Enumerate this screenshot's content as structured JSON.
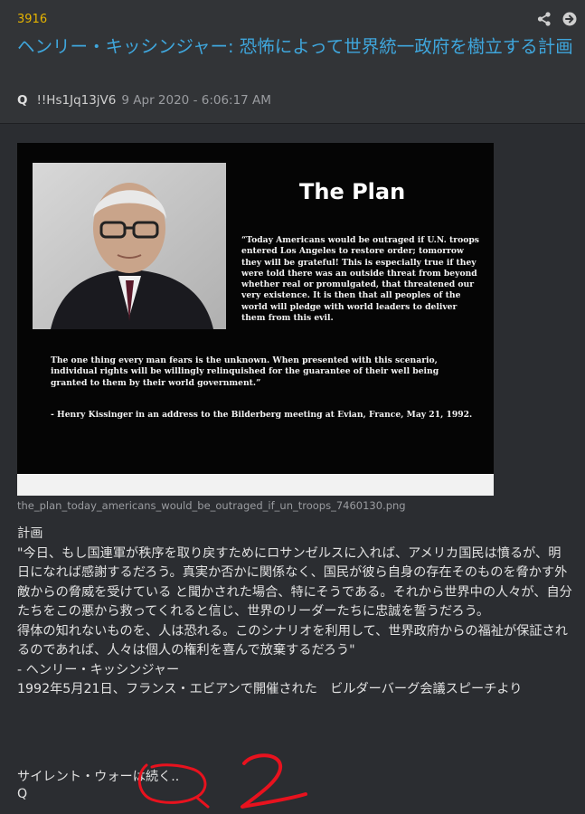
{
  "post": {
    "number": "3916",
    "title": "ヘンリー・キッシンジャー: 恐怖によって世界統一政府を樹立する計画",
    "author": "Q",
    "tripcode": "!!Hs1Jq13jV6",
    "timestamp": "9 Apr 2020 - 6:06:17 AM"
  },
  "icons": [
    "share-icon",
    "arrow-right-circle-icon"
  ],
  "image": {
    "heading": "The Plan",
    "quote_main": "“Today Americans would be outraged if U.N. troops entered Los Angeles to restore order; tomorrow they will be grateful! This is especially true if they were told there was an outside threat from beyond whether real or promulgated, that threatened our very existence. It is then that all peoples of the world will pledge with world leaders to deliver them from this evil.",
    "quote_second": "The one thing every man fears is the unknown. When presented with this scenario, individual rights will be willingly relinquished for the guarantee of their well being granted to them by their world government.”",
    "attribution_prefix": "- Henry Kissinger in an address to the ",
    "attribution_bold": "Bilderberg meeting at Evian",
    "attribution_suffix": ", France, May 21, 1992.",
    "filename": "the_plan_today_americans_would_be_outraged_if_un_troops_7460130.png"
  },
  "body": {
    "lines": [
      "計画",
      "\"今日、もし国連軍が秩序を取り戻すためにロサンゼルスに入れば、アメリカ国民は憤るが、明日になれば感謝するだろう。真実か否かに関係なく、国民が彼ら自身の存在そのものを脅かす外敵からの脅威を受けている と聞かされた場合、特にそうである。それから世界中の人々が、自分たちをこの悪から救ってくれると信じ、世界のリーダーたちに忠誠を誓うだろう。",
      "得体の知れないものを、人は恐れる。このシナリオを利用して、世界政府からの福祉が保証されるのであれば、人々は個人の権利を喜んで放棄するだろう\"",
      "- ヘンリー・キッシンジャー",
      "1992年5月21日、フランス・エビアンで開催された　ビルダーバーグ会議スピーチより"
    ],
    "silent_war": "サイレント・ウォーは続く..",
    "signature": "Q"
  },
  "colors": {
    "background": "#2b2d31",
    "title": "#3fa6dc",
    "post_number": "#e6b400",
    "annotation_red": "#e8121e"
  }
}
